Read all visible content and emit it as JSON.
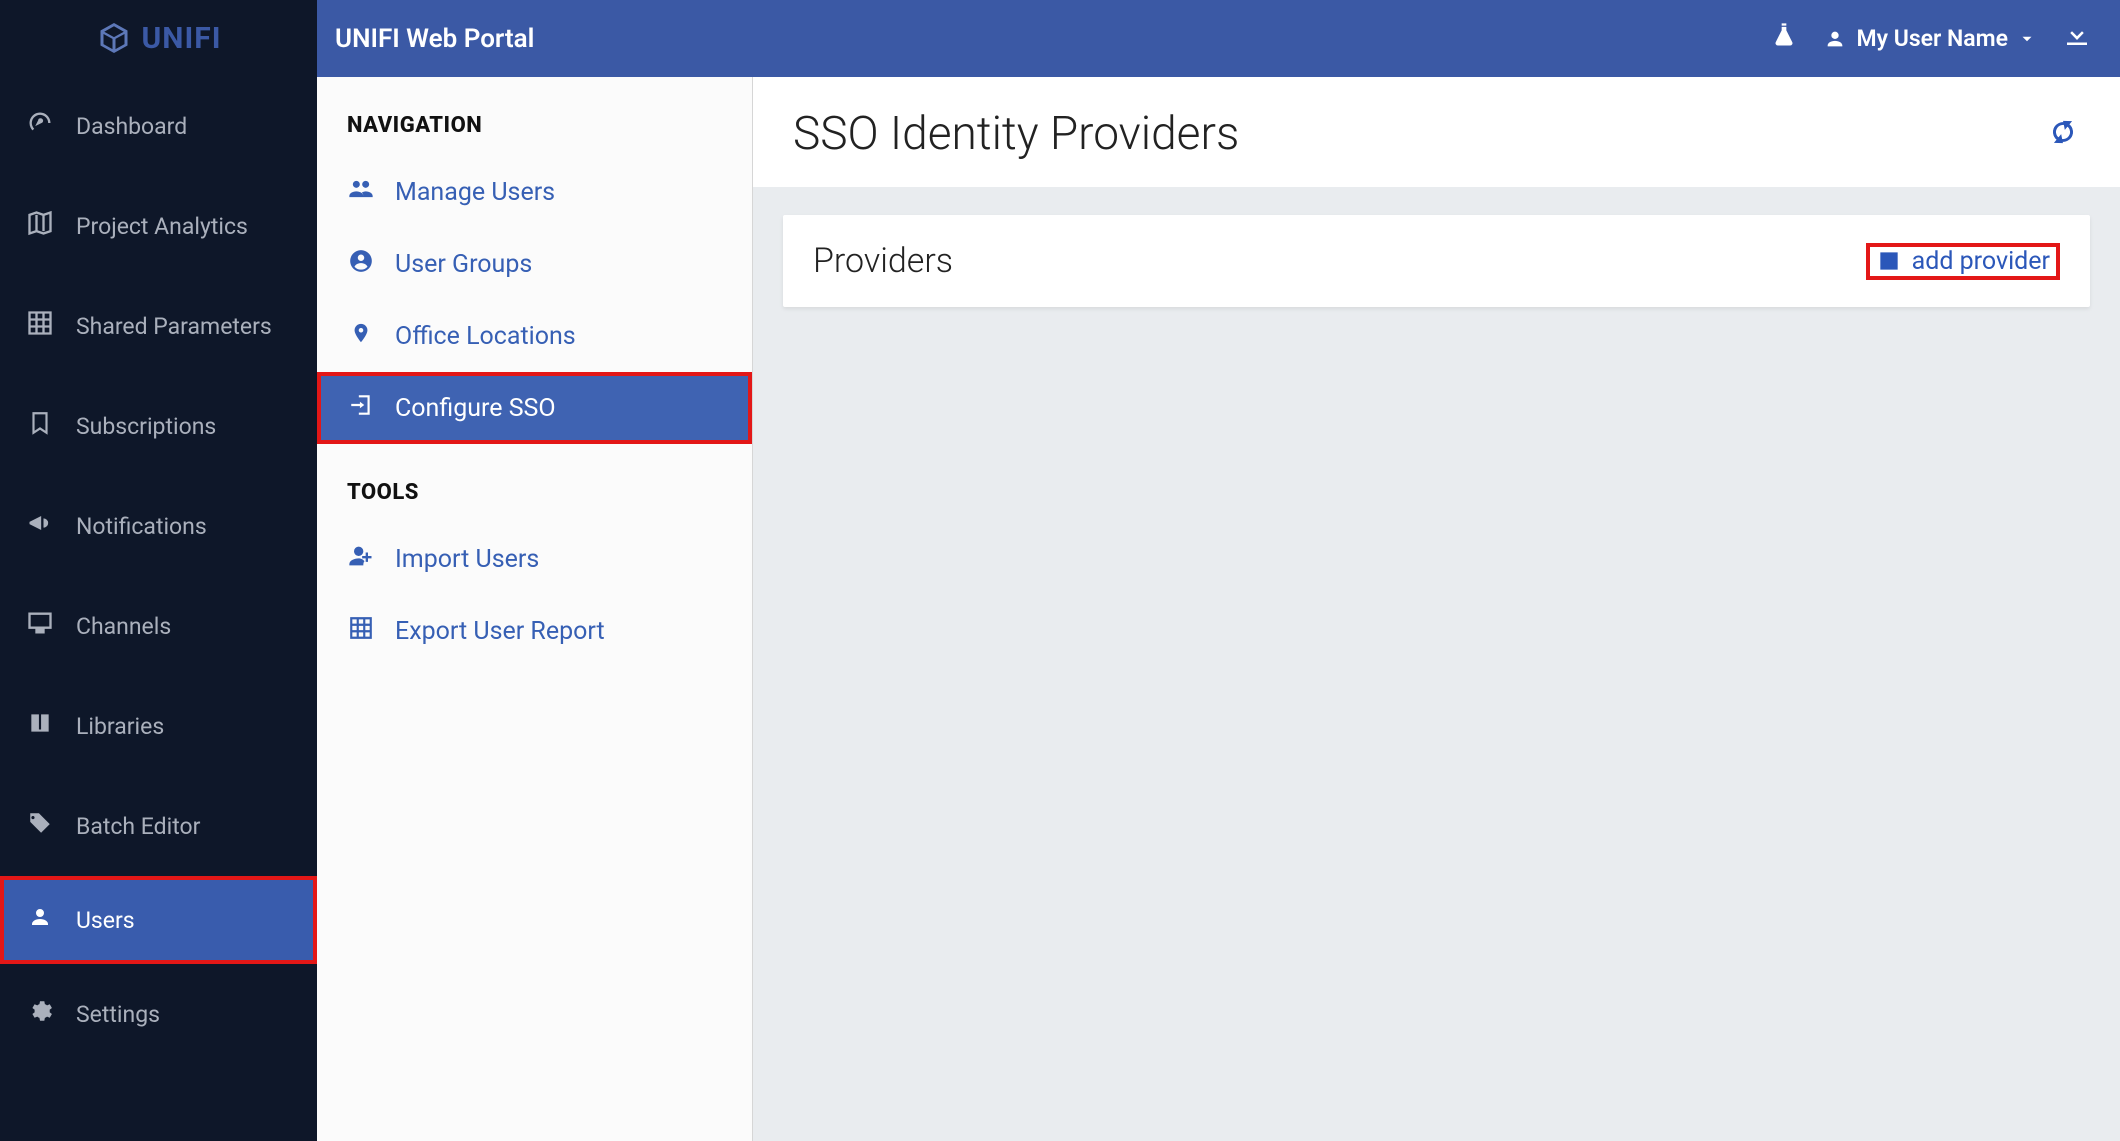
{
  "brand": {
    "name": "UNIFI"
  },
  "topbar": {
    "title": "UNIFI Web Portal",
    "user_label": "My User Name"
  },
  "sidebar": {
    "items": [
      {
        "label": "Dashboard"
      },
      {
        "label": "Project Analytics"
      },
      {
        "label": "Shared Parameters"
      },
      {
        "label": "Subscriptions"
      },
      {
        "label": "Notifications"
      },
      {
        "label": "Channels"
      },
      {
        "label": "Libraries"
      },
      {
        "label": "Batch Editor"
      },
      {
        "label": "Users",
        "active": true
      },
      {
        "label": "Settings"
      }
    ]
  },
  "secondary": {
    "navigation_heading": "NAVIGATION",
    "tools_heading": "TOOLS",
    "nav_items": [
      {
        "label": "Manage Users"
      },
      {
        "label": "User Groups"
      },
      {
        "label": "Office Locations"
      },
      {
        "label": "Configure SSO",
        "active": true
      }
    ],
    "tool_items": [
      {
        "label": "Import Users"
      },
      {
        "label": "Export User Report"
      }
    ]
  },
  "page": {
    "title": "SSO Identity Providers",
    "panel_heading": "Providers",
    "add_label": "add provider"
  }
}
